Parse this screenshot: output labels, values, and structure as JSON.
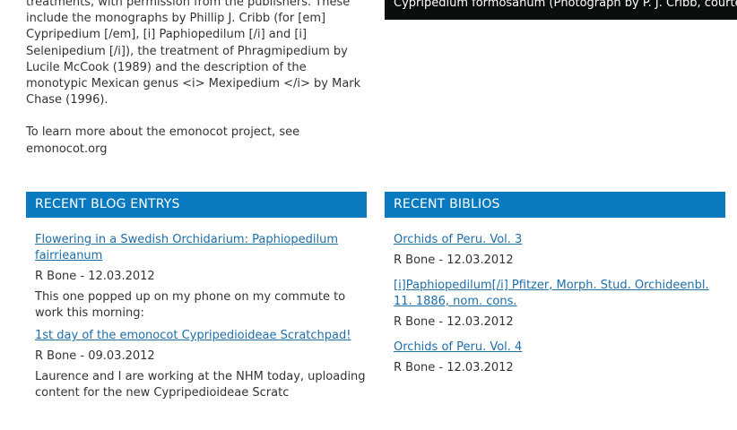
{
  "intro": {
    "paragraph": "treatments, with permission from the publishers. These include the monographs by Phillip J. Cribb (for [em] Cypripedium [/em], [i] Paphiopedilum [/i] and [i] Selenipedium [/i]), the treatment of  Phragmipedium by Lucile McCook (1989) and the description of the monotypic Mexican genus <i> Mexipedium </i> by Mark Chase (1996).",
    "learn_more": "To learn more about the emonocot project, see emonocot.org"
  },
  "photo": {
    "caption": "Cypripedium formosanum (Photograph by P. J. Cribb, courtesy"
  },
  "blog": {
    "heading": "RECENT BLOG ENTRYS",
    "entries": [
      {
        "title": "Flowering in a Swedish Orchidarium: Paphiopedilum fairrieanum",
        "meta": "R Bone - 12.03.2012",
        "teaser": "This one popped up on my phone on my commute to work this morning:"
      },
      {
        "title": "1st day of the emonocot Cypripedioideae Scratchpad!",
        "meta": "R Bone - 09.03.2012",
        "teaser": "Laurence and I are working at the NHM today, uploading content for the new Cypripedioideae Scratc"
      }
    ]
  },
  "biblio": {
    "heading": "RECENT BIBLIOS",
    "entries": [
      {
        "title": "Orchids of Peru. Vol. 3",
        "meta": "R Bone - 12.03.2012"
      },
      {
        "title": "[i]Paphiopedilum[/i] Pfitzer, Morph. Stud. Orchideenbl. 11. 1886, nom. cons.",
        "meta": "R Bone - 12.03.2012"
      },
      {
        "title": "Orchids of Peru. Vol. 4",
        "meta": "R Bone - 12.03.2012"
      }
    ]
  },
  "colors": {
    "header_bg": "#0a7ac0",
    "link": "#1e6ea8",
    "body_text": "#333333",
    "photo_bg": "#0b0f0c"
  }
}
